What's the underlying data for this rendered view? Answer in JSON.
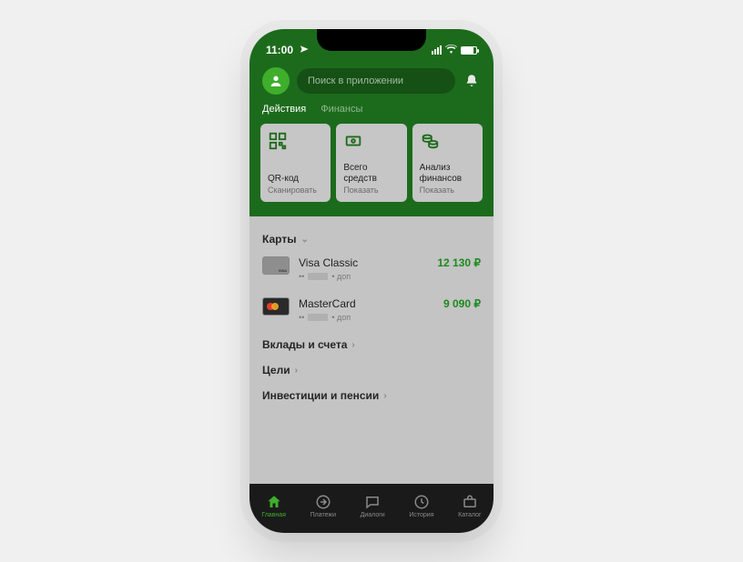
{
  "status": {
    "time": "11:00"
  },
  "search": {
    "placeholder": "Поиск в приложении"
  },
  "tabs": [
    {
      "label": "Действия",
      "active": true
    },
    {
      "label": "Финансы",
      "active": false
    }
  ],
  "actions": [
    {
      "title": "QR-код",
      "sub": "Сканировать"
    },
    {
      "title": "Всего средств",
      "sub": "Показать"
    },
    {
      "title": "Анализ финансов",
      "sub": "Показать"
    }
  ],
  "cards_section": {
    "title": "Карты"
  },
  "cards": [
    {
      "name": "Visa Classic",
      "masked": "••",
      "extra": "• доп",
      "balance": "12 130 ₽",
      "brand": "visa"
    },
    {
      "name": "MasterCard",
      "masked": "••",
      "extra": "• доп",
      "balance": "9 090 ₽",
      "brand": "mc"
    }
  ],
  "links": [
    {
      "label": "Вклады и счета"
    },
    {
      "label": "Цели"
    },
    {
      "label": "Инвестиции и пенсии"
    }
  ],
  "nav": [
    {
      "label": "Главная",
      "active": true
    },
    {
      "label": "Платежи",
      "active": false
    },
    {
      "label": "Диалоги",
      "active": false
    },
    {
      "label": "История",
      "active": false
    },
    {
      "label": "Каталог",
      "active": false
    }
  ]
}
